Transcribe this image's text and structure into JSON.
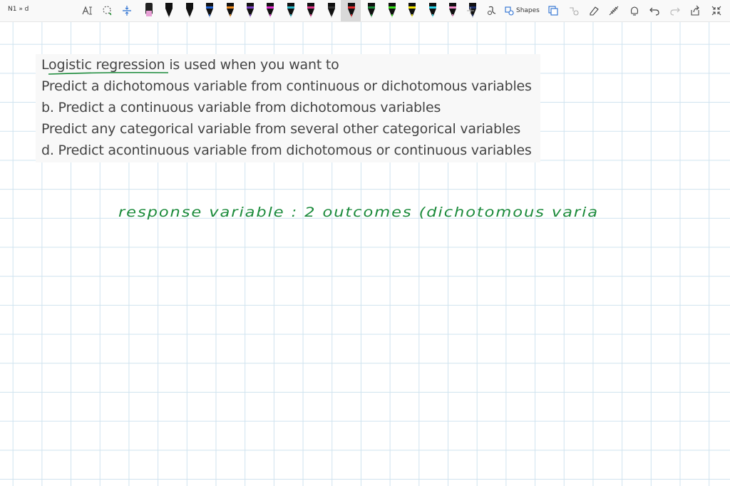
{
  "app": {
    "doc_title": "N1 » d",
    "shapes_label": "Shapes"
  },
  "colors": {
    "ink_green": "#1a8a3a",
    "grid": "#cfe3ef",
    "text_gray": "#444444"
  },
  "pens": [
    {
      "name": "highlighter-pink-pen",
      "color": "#e8a0d6"
    },
    {
      "name": "black-pen-1",
      "color": "#111111"
    },
    {
      "name": "black-pen-2",
      "color": "#111111"
    },
    {
      "name": "blue-pen",
      "color": "#1f5fd1"
    },
    {
      "name": "orange-pen",
      "color": "#f08a1a"
    },
    {
      "name": "purple-pen",
      "color": "#7a3fc4"
    },
    {
      "name": "magenta-pen",
      "color": "#e22bd0"
    },
    {
      "name": "cyan-pen",
      "color": "#26b6c9"
    },
    {
      "name": "pink-pen",
      "color": "#e0358a"
    },
    {
      "name": "dark-gray-pen",
      "color": "#333333"
    },
    {
      "name": "red-pen",
      "color": "#e0262a"
    },
    {
      "name": "green-pen-selected",
      "color": "#1a8a3a"
    },
    {
      "name": "bright-green-highlighter",
      "color": "#39e21d"
    },
    {
      "name": "yellow-highlighter",
      "color": "#f5e600"
    },
    {
      "name": "cyan-highlighter",
      "color": "#2ad3e8"
    },
    {
      "name": "pink-highlighter",
      "color": "#f28ac8"
    },
    {
      "name": "navy-pen",
      "color": "#1d2f6b"
    }
  ],
  "question": {
    "line1_underlined": "Logistic regression",
    "line1_rest": " is used when you want to",
    "option_a": "Predict a dichotomous variable from continuous or dichotomous variables",
    "option_b": "b. Predict a continuous variable from dichotomous variables",
    "option_c": "Predict any categorical variable from several other categorical variables",
    "option_d": "d. Predict acontinuous variable from dichotomous or continuous variables"
  },
  "handwriting": {
    "note": "response variable :  2 outcomes  (dichotomous varia"
  }
}
